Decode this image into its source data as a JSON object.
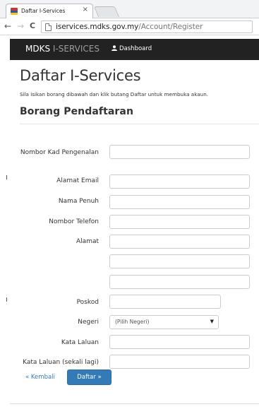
{
  "browser": {
    "tab_title": "Daftar I-Services",
    "tab_close": "×",
    "url_host": "iservices.mdks.gov.my",
    "url_path": "/Account/Register",
    "back_glyph": "←",
    "forward_glyph": "→",
    "reload_glyph": "C"
  },
  "navbar": {
    "brand_main": "MDKS",
    "brand_rest": " I-SERVICES",
    "dashboard_label": "Dashboard"
  },
  "page": {
    "title": "Daftar I-Services",
    "lead": "Sila isikan borang dibawah dan klik butang Daftar untuk membuka akaun.",
    "form_heading": "Borang Pendaftaran"
  },
  "form": {
    "ic_label": "Nombor Kad Pengenalan",
    "email_label": "Alamat Email",
    "name_label": "Nama Penuh",
    "phone_label": "Nombor Telefon",
    "address_label": "Alamat",
    "postcode_label": "Poskod",
    "state_label": "Negeri",
    "state_selected": "(Pilih Negeri)",
    "state_caret": "▼",
    "password_label": "Kata Laluan",
    "password_confirm_label": "Kata Laluan (sekali lagi)",
    "values": {
      "ic": "",
      "email": "",
      "name": "",
      "phone": "",
      "address1": "",
      "address2": "",
      "address3": "",
      "postcode": "",
      "password": "",
      "password_confirm": ""
    }
  },
  "actions": {
    "back_link": "« Kembali",
    "submit": "Daftar »"
  },
  "colors": {
    "navbar_bg": "#222222",
    "brand_secondary": "#9d9d9d",
    "primary": "#337ab7",
    "text": "#333333"
  },
  "icons": {
    "user": "user-icon",
    "favicon": "favicon-icon",
    "page": "page-icon"
  }
}
